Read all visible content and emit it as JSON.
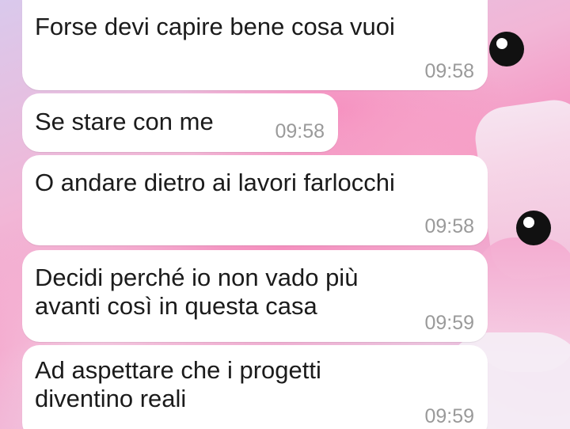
{
  "chat": {
    "messages": [
      {
        "text": "Forse devi capire bene cosa vuoi",
        "time": "09:58"
      },
      {
        "text": "Se stare con me",
        "time": "09:58"
      },
      {
        "text": "O andare dietro ai lavori farlocchi",
        "time": "09:58"
      },
      {
        "text": "Decidi perché io non vado più\navanti così in questa casa",
        "time": "09:59"
      },
      {
        "text": "Ad aspettare che i progetti\ndiventino reali",
        "time": "09:59"
      }
    ]
  },
  "theme": {
    "bubble_color": "#ffffff",
    "text_color": "#1b1b1b",
    "time_color": "#9a9a9a",
    "wallpaper_accent": "#f590bf"
  }
}
